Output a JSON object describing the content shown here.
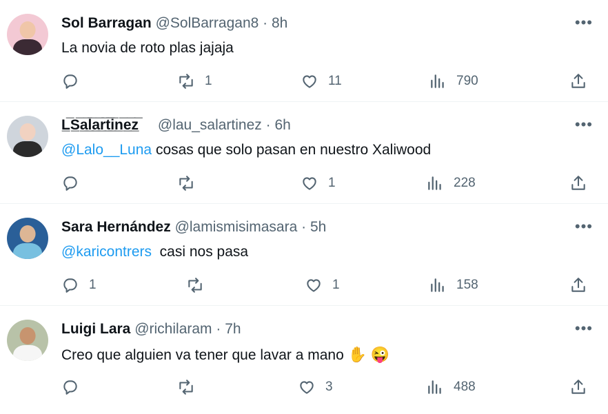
{
  "tweets": [
    {
      "name": "Sol Barragan",
      "handle": "@SolBarragan8",
      "separator": "·",
      "time": "8h",
      "content_parts": [
        {
          "text": "La novia de roto plas jajaja",
          "mention": false
        }
      ],
      "reply_count": "",
      "retweet_count": "1",
      "like_count": "11",
      "views_count": "790"
    },
    {
      "name": "L̲̅S̲̅a̲̅l̲̅a̲̅r̲̅t̲̅i̲̅n̲̅e̲̅z̲̅",
      "handle": "@lau_salartinez",
      "separator": "·",
      "time": "6h",
      "content_parts": [
        {
          "text": "@Lalo__Luna",
          "mention": true
        },
        {
          "text": " cosas que solo pasan en nuestro Xaliwood",
          "mention": false
        }
      ],
      "reply_count": "",
      "retweet_count": "",
      "like_count": "1",
      "views_count": "228"
    },
    {
      "name": "Sara Hernández",
      "handle": "@lamismisimasara",
      "separator": "·",
      "time": "5h",
      "content_parts": [
        {
          "text": "@karicontrers",
          "mention": true
        },
        {
          "text": "  casi nos pasa",
          "mention": false
        }
      ],
      "reply_count": "1",
      "retweet_count": "",
      "like_count": "1",
      "views_count": "158"
    },
    {
      "name": "Luigi Lara",
      "handle": "@richilaram",
      "separator": "·",
      "time": "7h",
      "content_parts": [
        {
          "text": "Creo que alguien va tener que lavar a mano ",
          "mention": false
        }
      ],
      "emojis": [
        "✋",
        "😜"
      ],
      "reply_count": "",
      "retweet_count": "",
      "like_count": "3",
      "views_count": "488"
    }
  ],
  "icons": {
    "more": "more-icon",
    "reply": "reply-icon",
    "retweet": "retweet-icon",
    "like": "like-icon",
    "views": "views-icon",
    "share": "share-icon"
  },
  "more_label": "•••",
  "colors": {
    "text": "#0f1419",
    "secondary": "#536471",
    "mention": "#1d9bf0",
    "divider": "#eff3f4"
  }
}
